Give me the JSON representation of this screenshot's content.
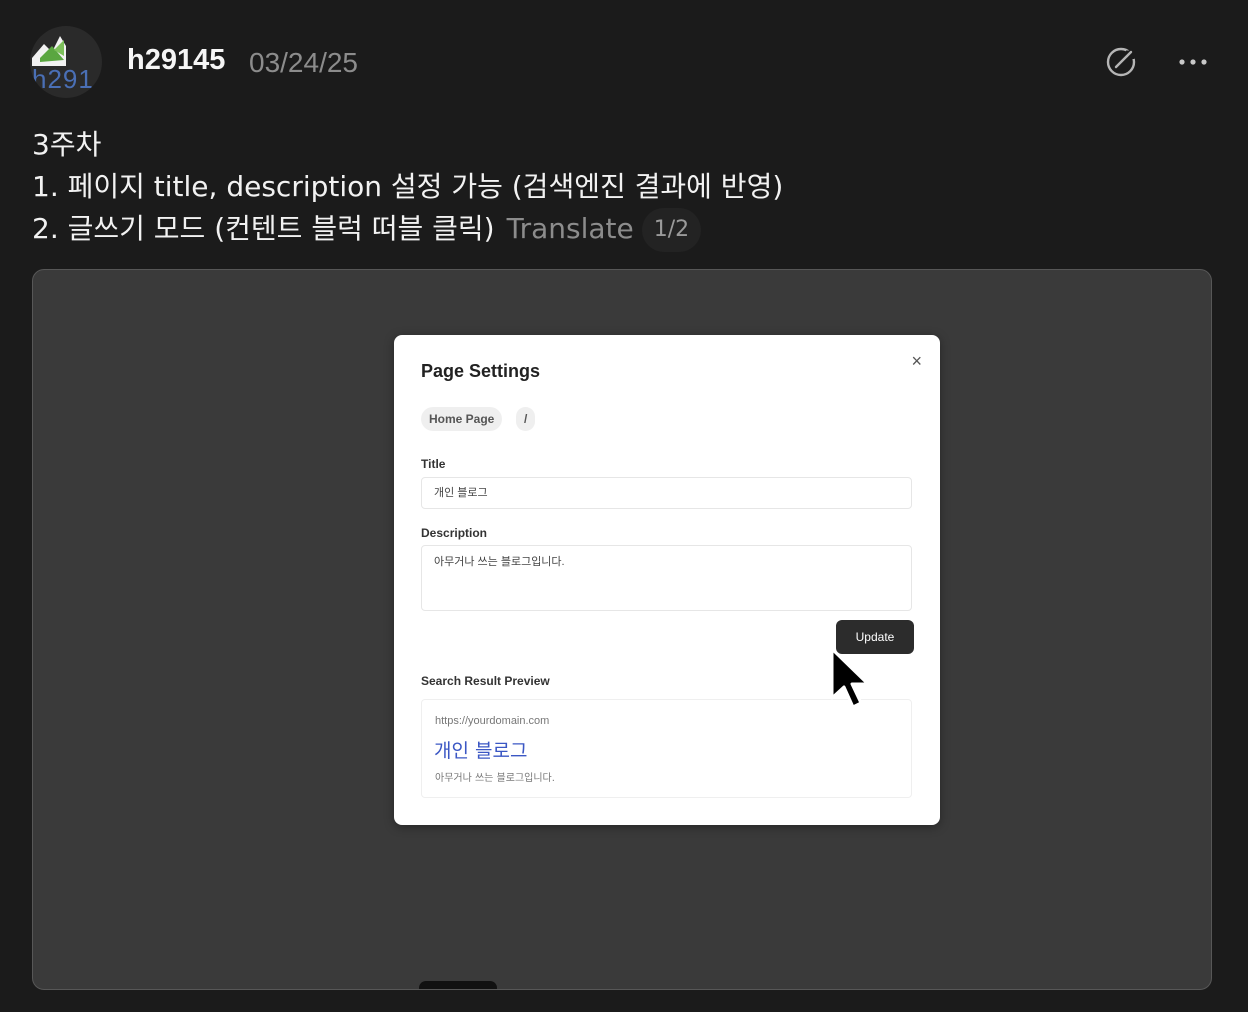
{
  "header": {
    "avatar_text": "h291",
    "username": "h29145",
    "date": "03/24/25",
    "icons": [
      "edit-circle-icon",
      "more-icon"
    ]
  },
  "post": {
    "lines": [
      "3주차",
      "1. 페이지 title, description 설정 가능 (검색엔진 결과에 반영)",
      "2. 글쓰기 모드 (컨텐트 블럭 떠블 클릭)"
    ],
    "translate_label": "Translate",
    "page_indicator": "1/2"
  },
  "modal": {
    "title": "Page Settings",
    "close_label": "×",
    "breadcrumb": [
      "Home Page",
      "/"
    ],
    "title_label": "Title",
    "title_value": "개인 블로그",
    "description_label": "Description",
    "description_value": "아무거나 쓰는 블로그입니다.",
    "update_label": "Update",
    "preview_label": "Search Result Preview",
    "preview": {
      "url": "https://yourdomain.com",
      "title": "개인 블로그",
      "description": "아무거나 쓰는 블로그입니다."
    }
  },
  "colors": {
    "background": "#1b1b1b",
    "media_bg": "#3a3a3a",
    "link_blue": "#3b57c4",
    "button_dark": "#2c2c2c"
  }
}
